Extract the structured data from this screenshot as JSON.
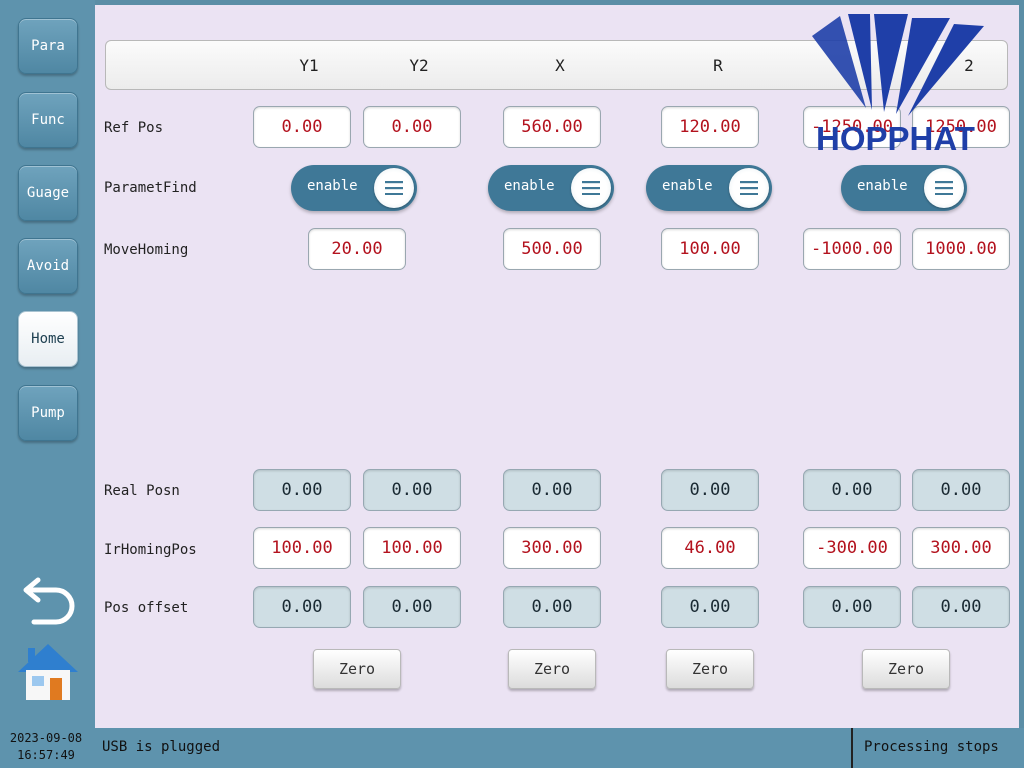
{
  "sidebar": {
    "items": [
      {
        "label": "Para"
      },
      {
        "label": "Func"
      },
      {
        "label": "Guage"
      },
      {
        "label": "Avoid"
      },
      {
        "label": "Home"
      },
      {
        "label": "Pump"
      }
    ],
    "active": "Home"
  },
  "columns": [
    "Y1",
    "Y2",
    "X",
    "R",
    "",
    "2"
  ],
  "rows": {
    "ref_pos": {
      "label": "Ref Pos",
      "values": [
        "0.00",
        "0.00",
        "560.00",
        "120.00",
        "-1250.00",
        "1250.00"
      ]
    },
    "paramet_find": {
      "label": "ParametFind",
      "toggles": [
        "enable",
        "enable",
        "enable",
        "enable"
      ]
    },
    "move_homing": {
      "label": "MoveHoming",
      "values": [
        "20.00",
        "500.00",
        "100.00",
        "-1000.00",
        "1000.00"
      ]
    },
    "real_posn": {
      "label": "Real Posn",
      "values": [
        "0.00",
        "0.00",
        "0.00",
        "0.00",
        "0.00",
        "0.00"
      ]
    },
    "ir_homing_pos": {
      "label": "IrHomingPos",
      "values": [
        "100.00",
        "100.00",
        "300.00",
        "46.00",
        "-300.00",
        "300.00"
      ]
    },
    "pos_offset": {
      "label": "Pos offset",
      "values": [
        "0.00",
        "0.00",
        "0.00",
        "0.00",
        "0.00",
        "0.00"
      ]
    }
  },
  "zero_buttons": [
    "Zero",
    "Zero",
    "Zero",
    "Zero"
  ],
  "logo": {
    "text": "HOPPHAT",
    "color": "#1f3fa8"
  },
  "statusbar": {
    "date": "2023-09-08",
    "time": "16:57:49",
    "usb": "USB is plugged",
    "process": "Processing stops"
  },
  "colors": {
    "accent": "#5e93ad",
    "panel": "#ebe3f3",
    "value_red": "#b3121e",
    "toggle": "#3f7897"
  }
}
